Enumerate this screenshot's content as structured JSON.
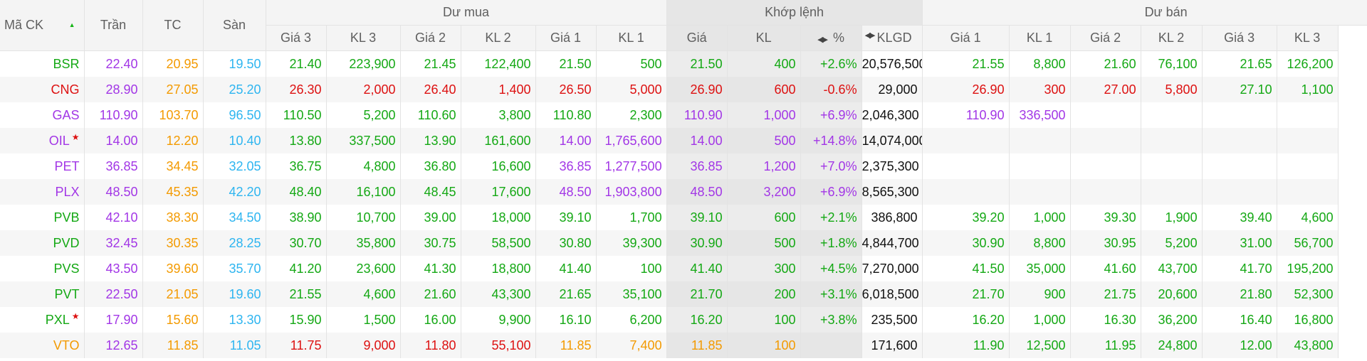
{
  "header": {
    "symbol": "Mã CK",
    "ceiling": "Trần",
    "ref": "TC",
    "floor": "Sàn",
    "bid_group": "Dư mua",
    "match_group": "Khớp lệnh",
    "ask_group": "Dư bán",
    "bid_cols": [
      "Giá 3",
      "KL 3",
      "Giá 2",
      "KL 2",
      "Giá 1",
      "KL 1"
    ],
    "match_cols": [
      "Giá",
      "KL",
      "%"
    ],
    "total_vol": "KLGD",
    "ask_cols": [
      "Giá 1",
      "KL 1",
      "Giá 2",
      "KL 2",
      "Giá 3",
      "KL 3"
    ]
  },
  "colors": {
    "up": "#14a814",
    "down": "#dd1111",
    "ceiling": "#a236e6",
    "reference": "#f39a00",
    "floor": "#2eb5f0"
  },
  "rows": [
    {
      "symbol": "BSR",
      "c": "up",
      "star": false,
      "ceil": "22.40",
      "ref": "20.95",
      "floor": "19.50",
      "bid": [
        [
          "21.40",
          "up"
        ],
        [
          "223,900",
          "up"
        ],
        [
          "21.45",
          "up"
        ],
        [
          "122,400",
          "up"
        ],
        [
          "21.50",
          "up"
        ],
        [
          "500",
          "up"
        ]
      ],
      "match": [
        [
          "21.50",
          "up"
        ],
        [
          "400",
          "up"
        ],
        [
          "+2.6%",
          "up"
        ]
      ],
      "klgd": "20,576,500",
      "ask": [
        [
          "21.55",
          "up"
        ],
        [
          "8,800",
          "up"
        ],
        [
          "21.60",
          "up"
        ],
        [
          "76,100",
          "up"
        ],
        [
          "21.65",
          "up"
        ],
        [
          "126,200",
          "up"
        ]
      ]
    },
    {
      "symbol": "CNG",
      "c": "down",
      "star": false,
      "ceil": "28.90",
      "ref": "27.05",
      "floor": "25.20",
      "bid": [
        [
          "26.30",
          "down"
        ],
        [
          "2,000",
          "down"
        ],
        [
          "26.40",
          "down"
        ],
        [
          "1,400",
          "down"
        ],
        [
          "26.50",
          "down"
        ],
        [
          "5,000",
          "down"
        ]
      ],
      "match": [
        [
          "26.90",
          "down"
        ],
        [
          "600",
          "down"
        ],
        [
          "-0.6%",
          "down"
        ]
      ],
      "klgd": "29,000",
      "ask": [
        [
          "26.90",
          "down"
        ],
        [
          "300",
          "down"
        ],
        [
          "27.00",
          "down"
        ],
        [
          "5,800",
          "down"
        ],
        [
          "27.10",
          "up"
        ],
        [
          "1,100",
          "up"
        ]
      ]
    },
    {
      "symbol": "GAS",
      "c": "ceil",
      "star": false,
      "ceil": "110.90",
      "ref": "103.70",
      "floor": "96.50",
      "bid": [
        [
          "110.50",
          "up"
        ],
        [
          "5,200",
          "up"
        ],
        [
          "110.60",
          "up"
        ],
        [
          "3,800",
          "up"
        ],
        [
          "110.80",
          "up"
        ],
        [
          "2,300",
          "up"
        ]
      ],
      "match": [
        [
          "110.90",
          "ceil"
        ],
        [
          "1,000",
          "ceil"
        ],
        [
          "+6.9%",
          "ceil"
        ]
      ],
      "klgd": "2,046,300",
      "ask": [
        [
          "110.90",
          "ceil"
        ],
        [
          "336,500",
          "ceil"
        ],
        [
          "",
          ""
        ],
        [
          "",
          ""
        ],
        [
          "",
          ""
        ],
        [
          "",
          ""
        ]
      ]
    },
    {
      "symbol": "OIL",
      "c": "ceil",
      "star": true,
      "ceil": "14.00",
      "ref": "12.20",
      "floor": "10.40",
      "bid": [
        [
          "13.80",
          "up"
        ],
        [
          "337,500",
          "up"
        ],
        [
          "13.90",
          "up"
        ],
        [
          "161,600",
          "up"
        ],
        [
          "14.00",
          "ceil"
        ],
        [
          "1,765,600",
          "ceil"
        ]
      ],
      "match": [
        [
          "14.00",
          "ceil"
        ],
        [
          "500",
          "ceil"
        ],
        [
          "+14.8%",
          "ceil"
        ]
      ],
      "klgd": "14,074,000",
      "ask": [
        [
          "",
          ""
        ],
        [
          "",
          ""
        ],
        [
          "",
          ""
        ],
        [
          "",
          ""
        ],
        [
          "",
          ""
        ],
        [
          "",
          ""
        ]
      ]
    },
    {
      "symbol": "PET",
      "c": "ceil",
      "star": false,
      "ceil": "36.85",
      "ref": "34.45",
      "floor": "32.05",
      "bid": [
        [
          "36.75",
          "up"
        ],
        [
          "4,800",
          "up"
        ],
        [
          "36.80",
          "up"
        ],
        [
          "16,600",
          "up"
        ],
        [
          "36.85",
          "ceil"
        ],
        [
          "1,277,500",
          "ceil"
        ]
      ],
      "match": [
        [
          "36.85",
          "ceil"
        ],
        [
          "1,200",
          "ceil"
        ],
        [
          "+7.0%",
          "ceil"
        ]
      ],
      "klgd": "2,375,300",
      "ask": [
        [
          "",
          ""
        ],
        [
          "",
          ""
        ],
        [
          "",
          ""
        ],
        [
          "",
          ""
        ],
        [
          "",
          ""
        ],
        [
          "",
          ""
        ]
      ]
    },
    {
      "symbol": "PLX",
      "c": "ceil",
      "star": false,
      "ceil": "48.50",
      "ref": "45.35",
      "floor": "42.20",
      "bid": [
        [
          "48.40",
          "up"
        ],
        [
          "16,100",
          "up"
        ],
        [
          "48.45",
          "up"
        ],
        [
          "17,600",
          "up"
        ],
        [
          "48.50",
          "ceil"
        ],
        [
          "1,903,800",
          "ceil"
        ]
      ],
      "match": [
        [
          "48.50",
          "ceil"
        ],
        [
          "3,200",
          "ceil"
        ],
        [
          "+6.9%",
          "ceil"
        ]
      ],
      "klgd": "8,565,300",
      "ask": [
        [
          "",
          ""
        ],
        [
          "",
          ""
        ],
        [
          "",
          ""
        ],
        [
          "",
          ""
        ],
        [
          "",
          ""
        ],
        [
          "",
          ""
        ]
      ]
    },
    {
      "symbol": "PVB",
      "c": "up",
      "star": false,
      "ceil": "42.10",
      "ref": "38.30",
      "floor": "34.50",
      "bid": [
        [
          "38.90",
          "up"
        ],
        [
          "10,700",
          "up"
        ],
        [
          "39.00",
          "up"
        ],
        [
          "18,000",
          "up"
        ],
        [
          "39.10",
          "up"
        ],
        [
          "1,700",
          "up"
        ]
      ],
      "match": [
        [
          "39.10",
          "up"
        ],
        [
          "600",
          "up"
        ],
        [
          "+2.1%",
          "up"
        ]
      ],
      "klgd": "386,800",
      "ask": [
        [
          "39.20",
          "up"
        ],
        [
          "1,000",
          "up"
        ],
        [
          "39.30",
          "up"
        ],
        [
          "1,900",
          "up"
        ],
        [
          "39.40",
          "up"
        ],
        [
          "4,600",
          "up"
        ]
      ]
    },
    {
      "symbol": "PVD",
      "c": "up",
      "star": false,
      "ceil": "32.45",
      "ref": "30.35",
      "floor": "28.25",
      "bid": [
        [
          "30.70",
          "up"
        ],
        [
          "35,800",
          "up"
        ],
        [
          "30.75",
          "up"
        ],
        [
          "58,500",
          "up"
        ],
        [
          "30.80",
          "up"
        ],
        [
          "39,300",
          "up"
        ]
      ],
      "match": [
        [
          "30.90",
          "up"
        ],
        [
          "500",
          "up"
        ],
        [
          "+1.8%",
          "up"
        ]
      ],
      "klgd": "4,844,700",
      "ask": [
        [
          "30.90",
          "up"
        ],
        [
          "8,800",
          "up"
        ],
        [
          "30.95",
          "up"
        ],
        [
          "5,200",
          "up"
        ],
        [
          "31.00",
          "up"
        ],
        [
          "56,700",
          "up"
        ]
      ]
    },
    {
      "symbol": "PVS",
      "c": "up",
      "star": false,
      "ceil": "43.50",
      "ref": "39.60",
      "floor": "35.70",
      "bid": [
        [
          "41.20",
          "up"
        ],
        [
          "23,600",
          "up"
        ],
        [
          "41.30",
          "up"
        ],
        [
          "18,800",
          "up"
        ],
        [
          "41.40",
          "up"
        ],
        [
          "100",
          "up"
        ]
      ],
      "match": [
        [
          "41.40",
          "up"
        ],
        [
          "300",
          "up"
        ],
        [
          "+4.5%",
          "up"
        ]
      ],
      "klgd": "7,270,000",
      "ask": [
        [
          "41.50",
          "up"
        ],
        [
          "35,000",
          "up"
        ],
        [
          "41.60",
          "up"
        ],
        [
          "43,700",
          "up"
        ],
        [
          "41.70",
          "up"
        ],
        [
          "195,200",
          "up"
        ]
      ]
    },
    {
      "symbol": "PVT",
      "c": "up",
      "star": false,
      "ceil": "22.50",
      "ref": "21.05",
      "floor": "19.60",
      "bid": [
        [
          "21.55",
          "up"
        ],
        [
          "4,600",
          "up"
        ],
        [
          "21.60",
          "up"
        ],
        [
          "43,300",
          "up"
        ],
        [
          "21.65",
          "up"
        ],
        [
          "35,100",
          "up"
        ]
      ],
      "match": [
        [
          "21.70",
          "up"
        ],
        [
          "200",
          "up"
        ],
        [
          "+3.1%",
          "up"
        ]
      ],
      "klgd": "6,018,500",
      "ask": [
        [
          "21.70",
          "up"
        ],
        [
          "900",
          "up"
        ],
        [
          "21.75",
          "up"
        ],
        [
          "20,600",
          "up"
        ],
        [
          "21.80",
          "up"
        ],
        [
          "52,300",
          "up"
        ]
      ]
    },
    {
      "symbol": "PXL",
      "c": "up",
      "star": true,
      "ceil": "17.90",
      "ref": "15.60",
      "floor": "13.30",
      "bid": [
        [
          "15.90",
          "up"
        ],
        [
          "1,500",
          "up"
        ],
        [
          "16.00",
          "up"
        ],
        [
          "9,900",
          "up"
        ],
        [
          "16.10",
          "up"
        ],
        [
          "6,200",
          "up"
        ]
      ],
      "match": [
        [
          "16.20",
          "up"
        ],
        [
          "100",
          "up"
        ],
        [
          "+3.8%",
          "up"
        ]
      ],
      "klgd": "235,500",
      "ask": [
        [
          "16.20",
          "up"
        ],
        [
          "1,000",
          "up"
        ],
        [
          "16.30",
          "up"
        ],
        [
          "36,200",
          "up"
        ],
        [
          "16.40",
          "up"
        ],
        [
          "16,800",
          "up"
        ]
      ]
    },
    {
      "symbol": "VTO",
      "c": "ref",
      "star": false,
      "ceil": "12.65",
      "ref": "11.85",
      "floor": "11.05",
      "bid": [
        [
          "11.75",
          "down"
        ],
        [
          "9,000",
          "down"
        ],
        [
          "11.80",
          "down"
        ],
        [
          "55,100",
          "down"
        ],
        [
          "11.85",
          "ref"
        ],
        [
          "7,400",
          "ref"
        ]
      ],
      "match": [
        [
          "11.85",
          "ref"
        ],
        [
          "100",
          "ref"
        ],
        [
          "",
          ""
        ]
      ],
      "klgd": "171,600",
      "ask": [
        [
          "11.90",
          "up"
        ],
        [
          "12,500",
          "up"
        ],
        [
          "11.95",
          "up"
        ],
        [
          "24,800",
          "up"
        ],
        [
          "12.00",
          "up"
        ],
        [
          "43,800",
          "up"
        ]
      ]
    }
  ]
}
